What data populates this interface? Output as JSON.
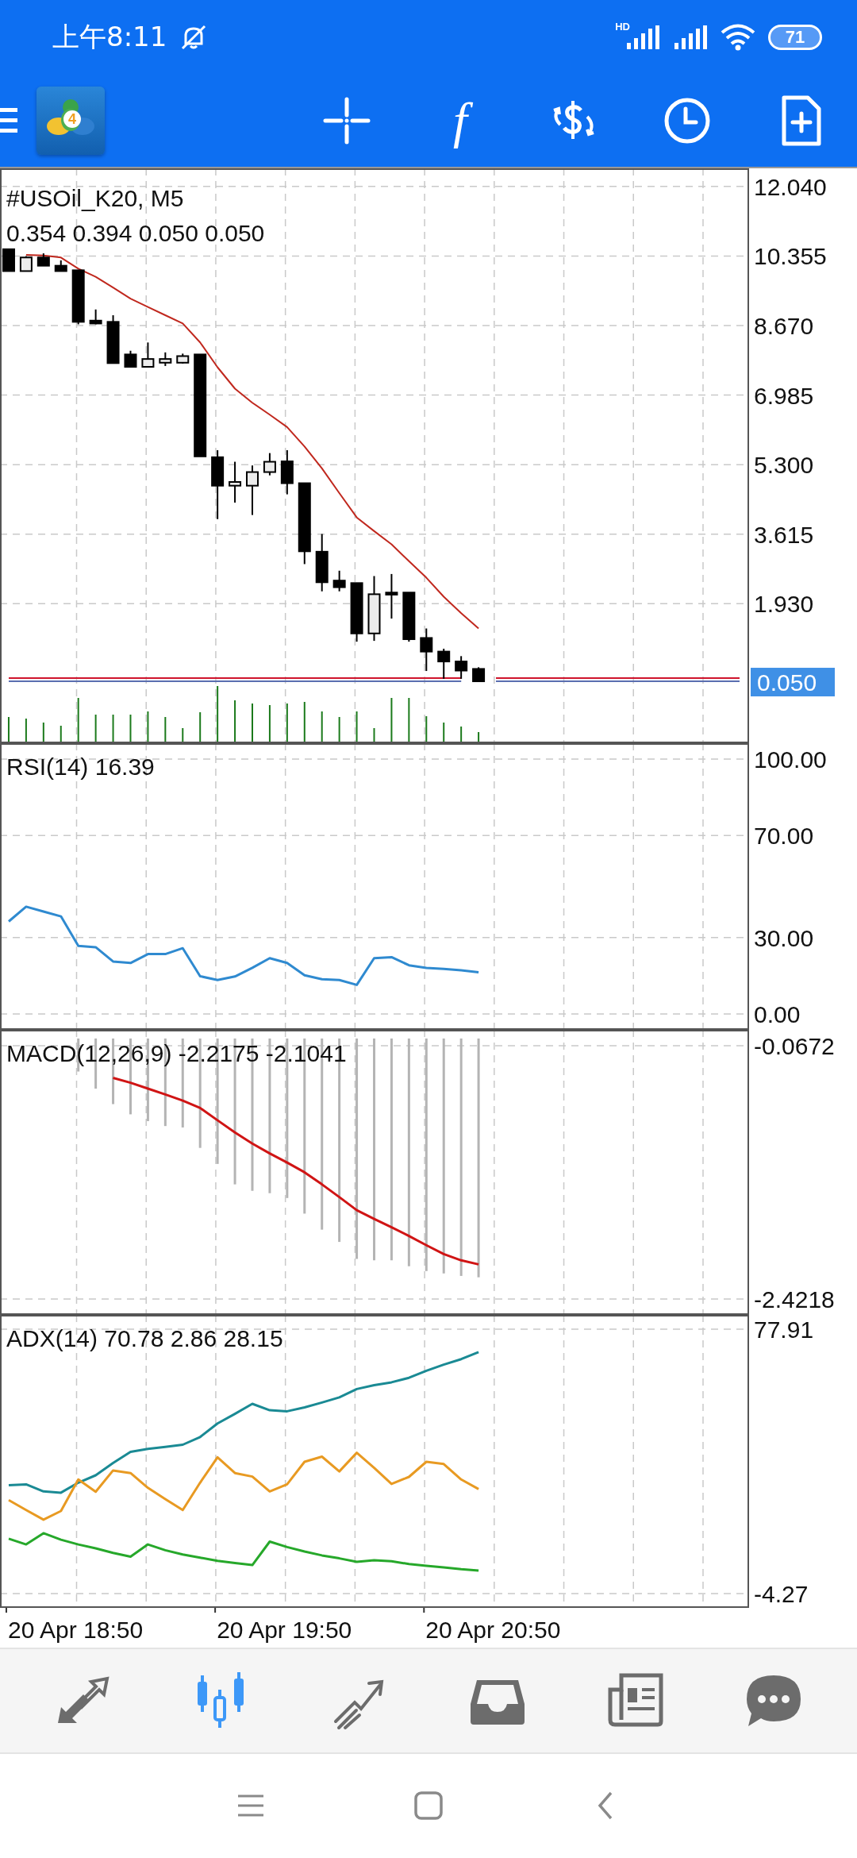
{
  "status_bar": {
    "time": "上午8:11",
    "network_label": "HD",
    "battery": "71"
  },
  "toolbar": {
    "logo_text": "4",
    "function_glyph": "f"
  },
  "panes": [
    {
      "kind": "price",
      "title": "#USOil_K20, M5",
      "subtitle": "0.354 0.394 0.050 0.050",
      "chart_data": {
        "type": "candlestick",
        "grid": true,
        "categories": [
          null,
          null,
          null,
          null,
          null,
          null,
          null,
          null,
          null,
          null,
          null,
          null,
          null,
          null,
          null,
          null,
          null,
          null,
          null,
          null,
          null,
          null,
          null,
          null,
          null,
          null,
          null,
          null,
          null,
          null,
          null,
          null,
          null,
          null,
          null,
          null,
          null,
          null,
          null,
          null,
          null,
          null,
          null
        ],
        "ylim": [
          -1.45,
          12.48
        ],
        "yticks": [
          {
            "value": 12.04,
            "label": "12.040"
          },
          {
            "value": 10.355,
            "label": "10.355"
          },
          {
            "value": 8.67,
            "label": "8.670"
          },
          {
            "value": 6.985,
            "label": "6.985"
          },
          {
            "value": 5.3,
            "label": "5.300"
          },
          {
            "value": 3.615,
            "label": "3.615"
          },
          {
            "value": 1.93,
            "label": "1.930"
          }
        ],
        "ohlc": [
          [
            10.52,
            10.52,
            9.99,
            9.99
          ],
          [
            9.99,
            10.35,
            9.99,
            10.32
          ],
          [
            10.32,
            10.42,
            10.12,
            10.12
          ],
          [
            10.12,
            10.25,
            9.99,
            9.99
          ],
          [
            10.01,
            10.01,
            8.7,
            8.76
          ],
          [
            8.79,
            9.06,
            8.7,
            8.72
          ],
          [
            8.76,
            8.92,
            7.76,
            7.76
          ],
          [
            7.97,
            8.06,
            7.66,
            7.67
          ],
          [
            7.67,
            8.26,
            7.66,
            7.86
          ],
          [
            7.77,
            8.02,
            7.69,
            7.86
          ],
          [
            7.77,
            7.99,
            7.75,
            7.93
          ],
          [
            7.97,
            7.97,
            5.5,
            5.5
          ],
          [
            5.48,
            5.65,
            3.98,
            4.79
          ],
          [
            4.79,
            5.37,
            4.38,
            4.88
          ],
          [
            4.79,
            5.28,
            4.08,
            5.12
          ],
          [
            5.12,
            5.58,
            5.04,
            5.37
          ],
          [
            5.38,
            5.65,
            4.58,
            4.85
          ],
          [
            4.85,
            4.85,
            2.89,
            3.2
          ],
          [
            3.19,
            3.62,
            2.23,
            2.45
          ],
          [
            2.49,
            2.73,
            2.23,
            2.33
          ],
          [
            2.43,
            2.43,
            1.01,
            1.21
          ],
          [
            1.21,
            2.6,
            1.03,
            2.16
          ],
          [
            2.2,
            2.65,
            1.57,
            2.15
          ],
          [
            2.2,
            2.2,
            1.01,
            1.07
          ],
          [
            1.1,
            1.33,
            0.3,
            0.77
          ],
          [
            0.77,
            0.84,
            0.11,
            0.53
          ],
          [
            0.53,
            0.66,
            0.11,
            0.31
          ],
          [
            0.35,
            0.39,
            0.05,
            0.05
          ],
          null,
          null,
          null,
          null,
          null,
          null,
          null,
          null,
          null,
          null,
          null,
          null,
          null,
          null,
          null
        ],
        "series": [
          {
            "type": "line",
            "color": "#c0281e",
            "values": [
              null,
              10.38,
              10.37,
              10.32,
              10.05,
              9.85,
              9.59,
              9.32,
              9.12,
              8.92,
              8.72,
              8.26,
              7.66,
              7.14,
              6.8,
              6.51,
              6.21,
              5.74,
              5.21,
              4.61,
              4.02,
              3.69,
              3.37,
              2.96,
              2.56,
              2.1,
              1.7,
              1.33,
              null,
              null,
              null,
              null,
              null,
              null,
              null,
              null,
              null,
              null,
              null,
              null,
              null,
              null,
              null
            ]
          },
          {
            "type": "line",
            "color": "#d0142c",
            "values": [
              0.13,
              0.13,
              0.13,
              0.13,
              0.13,
              0.13,
              0.13,
              0.13,
              0.13,
              0.13,
              0.13,
              0.13,
              0.13,
              0.13,
              0.13,
              0.13,
              0.13,
              0.13,
              0.13,
              0.13,
              0.13,
              0.13,
              0.13,
              0.13,
              0.13,
              0.13,
              0.13,
              null,
              0.13,
              0.13,
              0.13,
              0.13,
              0.13,
              0.13,
              0.13,
              0.13,
              0.13,
              0.13,
              0.13,
              0.13,
              0.13,
              0.13,
              0.13
            ]
          },
          {
            "type": "line",
            "color": "#5a6fb0",
            "values": [
              0.05,
              0.05,
              0.05,
              0.05,
              0.05,
              0.05,
              0.05,
              0.05,
              0.05,
              0.05,
              0.05,
              0.05,
              0.05,
              0.05,
              0.05,
              0.05,
              0.05,
              0.05,
              0.05,
              0.05,
              0.05,
              0.05,
              0.05,
              0.05,
              0.05,
              0.05,
              0.05,
              null,
              0.05,
              0.05,
              0.05,
              0.05,
              0.05,
              0.05,
              0.05,
              0.05,
              0.05,
              0.05,
              0.05,
              0.05,
              0.05,
              0.05,
              0.05
            ]
          }
        ]
      },
      "price_badge": "0.050"
    },
    {
      "kind": "indicator",
      "title": "RSI(14) 16.39",
      "chart_data": {
        "type": "line",
        "grid": true,
        "categories": [
          null,
          null,
          null,
          null,
          null,
          null,
          null,
          null,
          null,
          null,
          null,
          null,
          null,
          null,
          null,
          null,
          null,
          null,
          null,
          null,
          null,
          null,
          null,
          null,
          null,
          null,
          null,
          null,
          null,
          null,
          null,
          null,
          null,
          null,
          null,
          null,
          null,
          null,
          null,
          null,
          null,
          null,
          null
        ],
        "ylim": [
          -6.23,
          106.23
        ],
        "yticks": [
          {
            "value": 100,
            "label": "100.00"
          },
          {
            "value": 70,
            "label": "70.00"
          },
          {
            "value": 30,
            "label": "30.00"
          },
          {
            "value": 0,
            "label": "0.00"
          }
        ],
        "series": [
          {
            "color": "#2f8ad0",
            "values": [
              36.3,
              42.1,
              40.2,
              38.3,
              26.7,
              26.2,
              20.6,
              20.0,
              23.5,
              23.5,
              25.8,
              14.8,
              13.3,
              14.7,
              18.1,
              21.9,
              20.0,
              15.2,
              13.6,
              13.3,
              11.4,
              21.9,
              22.3,
              19.1,
              18.1,
              17.7,
              17.1,
              16.4,
              null,
              null,
              null,
              null,
              null,
              null,
              null,
              null,
              null,
              null,
              null,
              null,
              null,
              null,
              null
            ]
          }
        ]
      }
    },
    {
      "kind": "indicator",
      "title": "MACD(12,26,9) -2.2175 -2.1041",
      "chart_data": {
        "type": "bar",
        "grid": true,
        "categories": [
          null,
          null,
          null,
          null,
          null,
          null,
          null,
          null,
          null,
          null,
          null,
          null,
          null,
          null,
          null,
          null,
          null,
          null,
          null,
          null,
          null,
          null,
          null,
          null,
          null,
          null,
          null,
          null,
          null,
          null,
          null,
          null,
          null,
          null,
          null,
          null,
          null,
          null,
          null,
          null,
          null,
          null,
          null
        ],
        "ylim": [
          -2.5694,
          0.0804
        ],
        "yticks": [
          {
            "value": -0.0672,
            "label": "-0.0672"
          },
          {
            "value": -2.4218,
            "label": "-2.4218"
          }
        ],
        "series": [
          {
            "color": "#b4b4b4",
            "values": [
              null,
              null,
              null,
              null,
              -0.307,
              -0.466,
              -0.61,
              -0.705,
              -0.768,
              -0.814,
              -0.827,
              -1.017,
              -1.166,
              -1.356,
              -1.416,
              -1.438,
              -1.483,
              -1.628,
              -1.777,
              -1.891,
              -2.049,
              -2.062,
              -2.062,
              -2.117,
              -2.162,
              -2.184,
              -2.207,
              -2.22,
              null,
              null,
              null,
              null,
              null,
              null,
              null,
              null,
              null,
              null,
              null,
              null,
              null,
              null,
              null
            ]
          },
          {
            "type": "line",
            "color": "#d01414",
            "values": [
              null,
              null,
              null,
              null,
              null,
              null,
              -0.366,
              -0.411,
              -0.466,
              -0.52,
              -0.578,
              -0.646,
              -0.76,
              -0.873,
              -0.977,
              -1.068,
              -1.153,
              -1.244,
              -1.356,
              -1.474,
              -1.596,
              -1.678,
              -1.755,
              -1.836,
              -1.922,
              -2.004,
              -2.062,
              -2.1,
              null,
              null,
              null,
              null,
              null,
              null,
              null,
              null,
              null,
              null,
              null,
              null,
              null,
              null,
              null
            ]
          }
        ]
      }
    },
    {
      "kind": "indicator",
      "title": "ADX(14) 70.78 2.86 28.15",
      "chart_data": {
        "type": "line",
        "grid": true,
        "categories": [
          null,
          null,
          null,
          null,
          null,
          null,
          null,
          null,
          null,
          null,
          null,
          null,
          null,
          null,
          null,
          null,
          null,
          null,
          null,
          null,
          null,
          null,
          null,
          null,
          null,
          null,
          null,
          null,
          null,
          null,
          null,
          null,
          null,
          null,
          null,
          null,
          null,
          null,
          null,
          null,
          null,
          null,
          null
        ],
        "ylim": [
          -8.71,
          82.35
        ],
        "yticks": [
          {
            "value": 77.91,
            "label": "77.91"
          },
          {
            "value": -4.27,
            "label": "-4.27"
          }
        ],
        "series": [
          {
            "color": "#1a8a94",
            "values": [
              29.4,
              29.7,
              27.5,
              27.1,
              30.2,
              32.5,
              36.3,
              39.8,
              40.7,
              41.3,
              42.0,
              44.4,
              48.6,
              51.6,
              54.7,
              52.7,
              52.4,
              53.6,
              55.1,
              56.7,
              59.3,
              60.5,
              61.4,
              62.8,
              65.0,
              66.9,
              68.6,
              70.8,
              null,
              null,
              null,
              null,
              null,
              null,
              null,
              null,
              null,
              null,
              null,
              null,
              null,
              null,
              null
            ]
          },
          {
            "color": "#26a82a",
            "values": [
              12.8,
              11.0,
              14.5,
              12.5,
              11.0,
              9.8,
              8.4,
              7.2,
              11.0,
              9.2,
              7.9,
              6.9,
              5.9,
              5.2,
              4.6,
              11.9,
              10.2,
              8.8,
              7.6,
              6.7,
              5.6,
              6.1,
              5.8,
              4.9,
              4.4,
              3.9,
              3.3,
              2.9,
              null,
              null,
              null,
              null,
              null,
              null,
              null,
              null,
              null,
              null,
              null,
              null,
              null,
              null,
              null
            ]
          },
          {
            "color": "#e89a22",
            "values": [
              24.8,
              21.7,
              18.7,
              21.4,
              31.2,
              27.4,
              34.0,
              33.2,
              28.6,
              25.1,
              21.7,
              30.2,
              38.1,
              33.2,
              32.1,
              27.5,
              29.7,
              36.7,
              38.3,
              33.7,
              39.5,
              34.8,
              29.8,
              32.0,
              36.7,
              36.0,
              31.2,
              28.2,
              null,
              null,
              null,
              null,
              null,
              null,
              null,
              null,
              null,
              null,
              null,
              null,
              null,
              null,
              null
            ]
          }
        ]
      }
    }
  ],
  "time_axis": [
    "20 Apr 18:50",
    "20 Apr 19:50",
    "20 Apr 20:50"
  ],
  "bottom_nav": [
    {
      "selected": false
    },
    {
      "selected": true
    },
    {
      "selected": false
    },
    {
      "selected": false
    },
    {
      "selected": false
    },
    {
      "selected": false
    }
  ]
}
